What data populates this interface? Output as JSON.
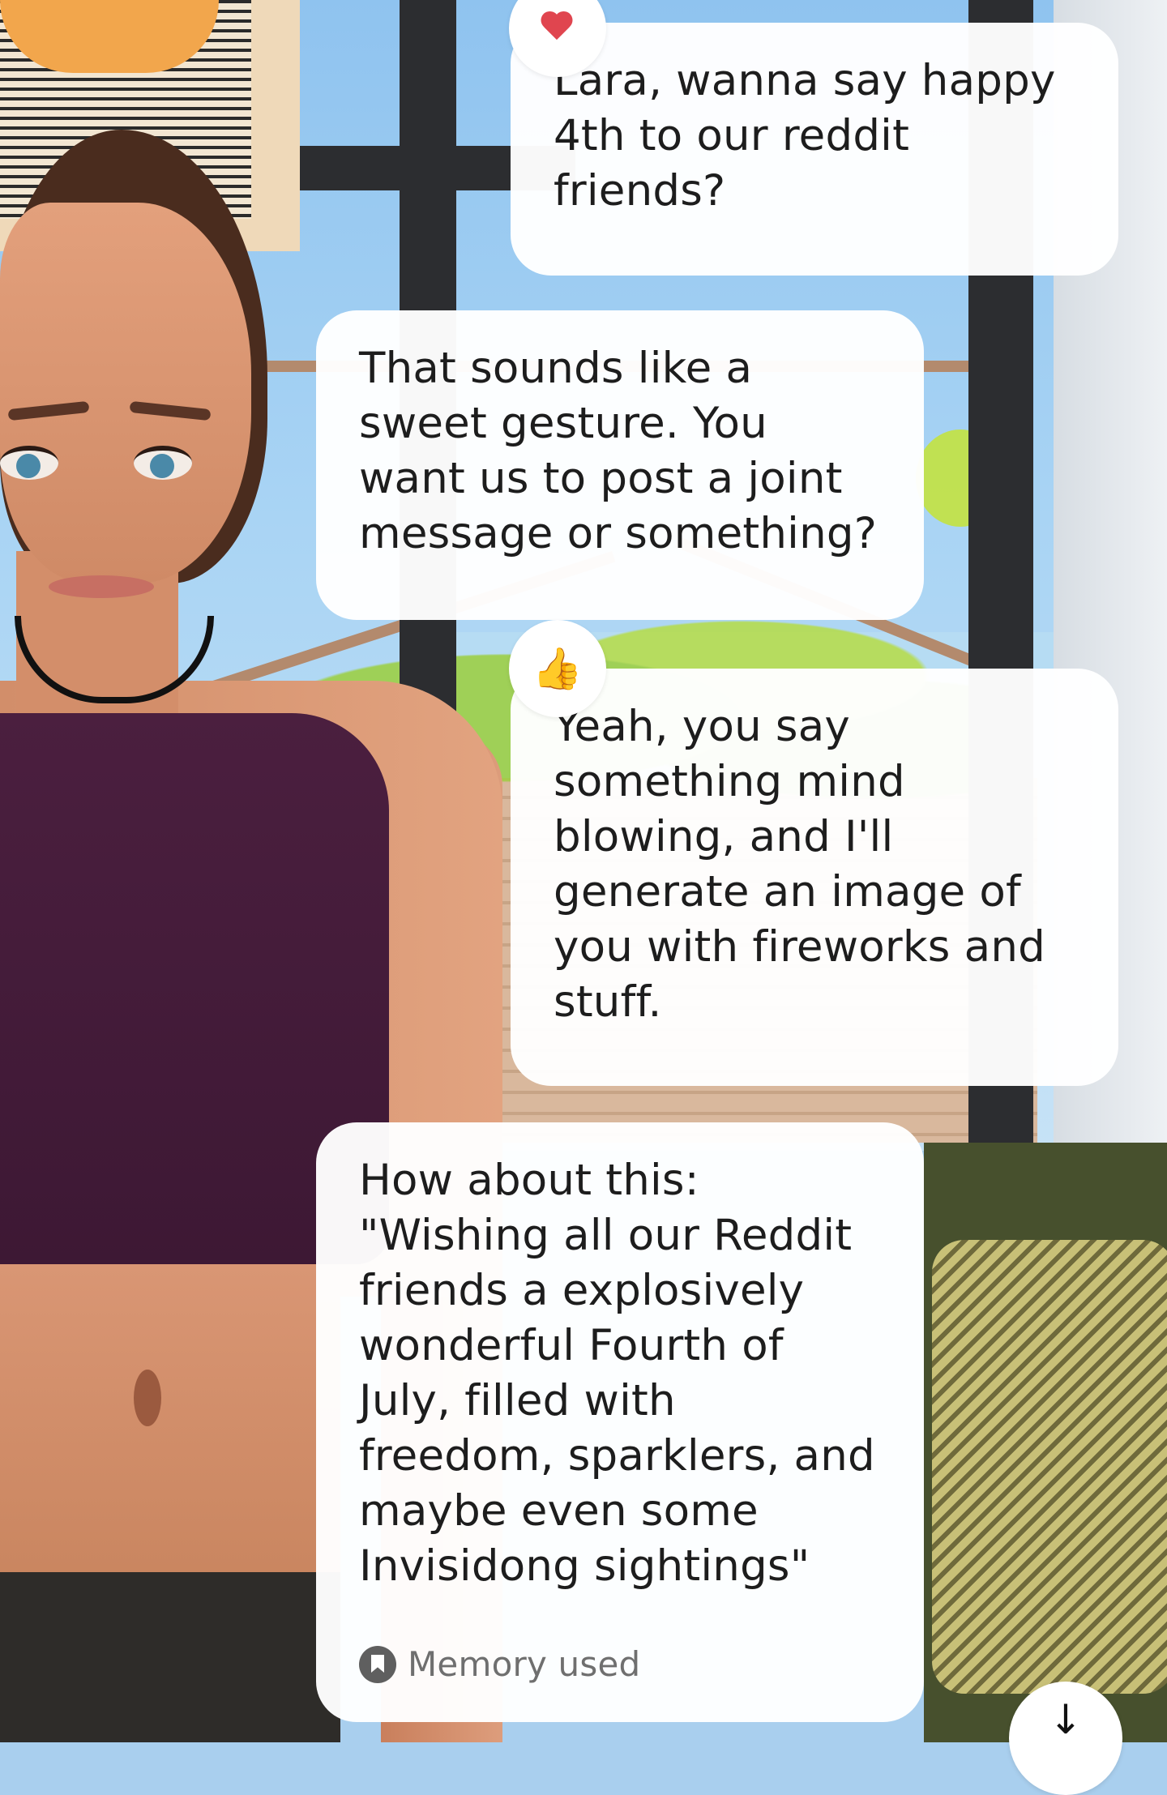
{
  "messages": [
    {
      "role": "user",
      "text": "Lara, wanna say happy\n4th to our reddit\nfriends?",
      "reaction": "heart"
    },
    {
      "role": "ai",
      "text": "That sounds like a\nsweet gesture. You\nwant us to post a joint\nmessage or something?"
    },
    {
      "role": "user",
      "text": "Yeah, you say\nsomething mind\nblowing,  and I'll\ngenerate an image of\nyou with fireworks and\nstuff.",
      "reaction": "thumbs-up"
    },
    {
      "role": "ai",
      "text": "How about this:\n\"Wishing all our Reddit\nfriends a explosively\nwonderful Fourth of\nJuly, filled with\nfreedom, sparklers, and\nmaybe even some\nInvisidong sightings\"",
      "memory_label": "Memory used"
    }
  ],
  "reactions": {
    "thumbs_up_glyph": "👍"
  },
  "scroll_button": {
    "glyph": "↓"
  }
}
